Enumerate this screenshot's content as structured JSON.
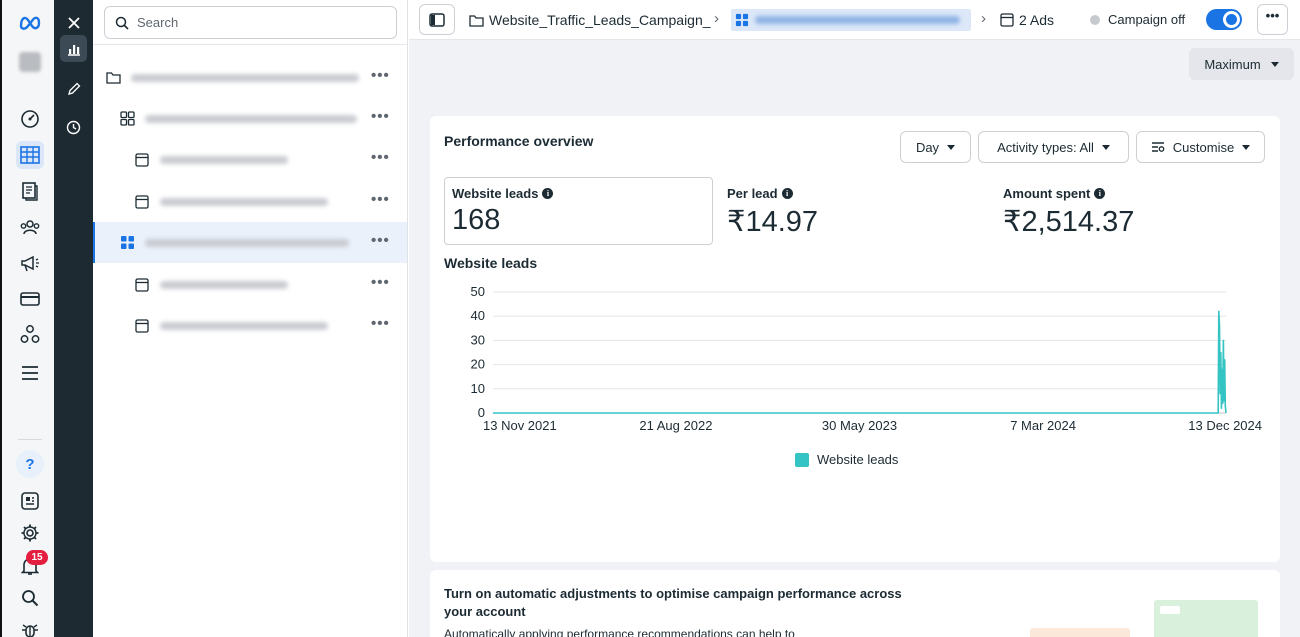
{
  "nav": {
    "icons": [
      "meta-logo",
      "account-avatar",
      "dashboard-icon",
      "campaigns-table-icon",
      "pages-icon",
      "audiences-icon",
      "advertise-icon",
      "billing-icon",
      "business-icon",
      "menu-icon",
      "help-icon",
      "news-icon",
      "settings-icon",
      "notifications-icon",
      "search-icon",
      "bug-icon"
    ],
    "notifications_badge": "15"
  },
  "rail": {
    "icons": [
      "close-icon",
      "chart-icon",
      "edit-icon",
      "history-icon"
    ]
  },
  "tree": {
    "search_placeholder": "Search",
    "rows": [
      {
        "type": "campaign",
        "selected": false
      },
      {
        "type": "adset",
        "selected": false
      },
      {
        "type": "ad",
        "selected": false
      },
      {
        "type": "ad",
        "selected": false
      },
      {
        "type": "adset",
        "selected": true
      },
      {
        "type": "ad",
        "selected": false
      },
      {
        "type": "ad",
        "selected": false
      }
    ],
    "more_label": "•••"
  },
  "topbar": {
    "campaign_crumb": "Website_Traffic_Leads_Campaign_",
    "ads_crumb": "2 Ads",
    "status": "Campaign off",
    "more_label": "•••"
  },
  "maximum_label": "Maximum",
  "overview": {
    "title": "Performance overview",
    "controls": {
      "day": "Day",
      "activity": "Activity types: All",
      "customise": "Customise"
    },
    "metrics": [
      {
        "label": "Website leads",
        "value": "168"
      },
      {
        "label": "Per lead",
        "value": "₹14.97"
      },
      {
        "label": "Amount spent",
        "value": "₹2,514.37"
      }
    ],
    "chart_title": "Website leads",
    "legend": "Website leads"
  },
  "chart_data": {
    "type": "line",
    "title": "Website leads",
    "xlabel": "",
    "ylabel": "",
    "ylim": [
      0,
      50
    ],
    "yticks": [
      0,
      10,
      20,
      30,
      40,
      50
    ],
    "xticks": [
      "13 Nov 2021",
      "21 Aug 2022",
      "30 May 2023",
      "7 Mar 2024",
      "13 Dec 2024"
    ],
    "grid": true,
    "legend_position": "bottom",
    "series": [
      {
        "name": "Website leads",
        "color": "#34c4c4",
        "x": [
          "13 Nov 2021",
          "21 Aug 2022",
          "30 May 2023",
          "7 Mar 2024",
          "1 Dec 2024",
          "2 Dec 2024",
          "3 Dec 2024",
          "4 Dec 2024",
          "5 Dec 2024",
          "6 Dec 2024",
          "7 Dec 2024",
          "8 Dec 2024",
          "9 Dec 2024",
          "10 Dec 2024",
          "11 Dec 2024",
          "12 Dec 2024",
          "13 Dec 2024"
        ],
        "y": [
          0,
          0,
          0,
          0,
          0,
          42,
          36,
          8,
          25,
          2,
          18,
          4,
          30,
          5,
          22,
          3,
          0
        ]
      }
    ]
  },
  "recommendation": {
    "title": "Turn on automatic adjustments to optimise campaign performance across your account",
    "text": "Automatically applying performance recommendations can help to"
  }
}
